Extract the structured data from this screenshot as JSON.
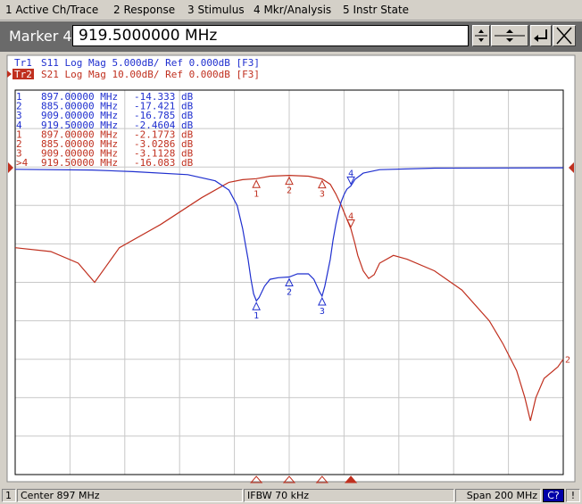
{
  "menu": [
    "1 Active Ch/Trace",
    "2 Response",
    "3 Stimulus",
    "4 Mkr/Analysis",
    "5 Instr State"
  ],
  "entry": {
    "label": "Marker 4",
    "value": "919.5000000 MHz"
  },
  "traces": [
    {
      "id": "Tr1",
      "text": "S11 Log Mag 5.000dB/ Ref 0.000dB [F3]",
      "color": "#1f2fcf"
    },
    {
      "id": "Tr2",
      "text": "S21 Log Mag 10.00dB/ Ref 0.000dB [F3]",
      "color": "#c0301f"
    }
  ],
  "markers_s11": [
    {
      "num": "1",
      "freq": "897.00000 MHz",
      "value": "-14.333 dB"
    },
    {
      "num": "2",
      "freq": "885.00000 MHz",
      "value": "-17.421 dB"
    },
    {
      "num": "3",
      "freq": "909.00000 MHz",
      "value": "-16.785 dB"
    },
    {
      "num": "4",
      "freq": "919.50000 MHz",
      "value": "-2.4604 dB"
    }
  ],
  "markers_s21": [
    {
      "num": "1",
      "freq": "897.00000 MHz",
      "value": "-2.1773 dB"
    },
    {
      "num": "2",
      "freq": "885.00000 MHz",
      "value": "-3.0286 dB"
    },
    {
      "num": "3",
      "freq": "909.00000 MHz",
      "value": "-3.1128 dB"
    },
    {
      "num": ">4",
      "freq": "919.50000 MHz",
      "value": "-16.083 dB"
    }
  ],
  "plot_labels": {
    "s11_marker_nums": [
      "2",
      "1",
      "3",
      "4"
    ],
    "s21_marker_nums": [
      "2",
      "1",
      "3",
      "4"
    ],
    "s21_end_label": "2"
  },
  "status": {
    "channel": "1",
    "center": "Center 897 MHz",
    "ifbw": "IFBW 70 kHz",
    "span": "Span 200 MHz",
    "c2f": "C?",
    "warn": "!"
  },
  "chart_data": {
    "type": "line",
    "x_axis": {
      "center_mhz": 897,
      "span_mhz": 200,
      "range_mhz": [
        797,
        997
      ],
      "divisions": 10
    },
    "series": [
      {
        "name": "S11",
        "scale_db_per_div": 5,
        "ref_db": 0,
        "ref_div_from_top": 2,
        "x": [
          797,
          825,
          840,
          860,
          870,
          875,
          878,
          880,
          882,
          883,
          884,
          885,
          886,
          888,
          890,
          893,
          897,
          900,
          904,
          906,
          908,
          909,
          910,
          912,
          913,
          914,
          915,
          916,
          917,
          918,
          919.5,
          921,
          924,
          930,
          950,
          997
        ],
        "y": [
          -0.3,
          -0.4,
          -0.6,
          -1.0,
          -1.8,
          -3.0,
          -5.0,
          -8.0,
          -12.0,
          -14.5,
          -16.5,
          -17.4,
          -17.0,
          -15.5,
          -14.6,
          -14.4,
          -14.3,
          -13.9,
          -13.9,
          -14.6,
          -16.2,
          -16.8,
          -15.5,
          -12.0,
          -9.5,
          -7.5,
          -5.8,
          -4.5,
          -3.6,
          -2.9,
          -2.46,
          -1.6,
          -0.8,
          -0.35,
          -0.15,
          -0.1
        ]
      },
      {
        "name": "S21",
        "scale_db_per_div": 10,
        "ref_db": 0,
        "ref_div_from_top": 2,
        "x": [
          797,
          810,
          820,
          826,
          830,
          835,
          850,
          865,
          875,
          880,
          885,
          890,
          897,
          904,
          909,
          912,
          914,
          916,
          918,
          919.5,
          921,
          922,
          924,
          926,
          928,
          930,
          935,
          940,
          950,
          960,
          970,
          975,
          980,
          983,
          985,
          987,
          990,
          995,
          997
        ],
        "y": [
          -21,
          -22,
          -25,
          -30,
          -26,
          -21,
          -15,
          -8,
          -4,
          -3.3,
          -3.03,
          -2.4,
          -2.18,
          -2.4,
          -3.11,
          -4.5,
          -7,
          -10,
          -13.5,
          -16.08,
          -20,
          -23,
          -27,
          -29,
          -28,
          -25,
          -23,
          -24,
          -27,
          -32,
          -40,
          -46,
          -53,
          -60,
          -66,
          -60,
          -55,
          -52,
          -50
        ]
      }
    ],
    "marker_positions_mhz": [
      897,
      885,
      909,
      919.5
    ]
  }
}
